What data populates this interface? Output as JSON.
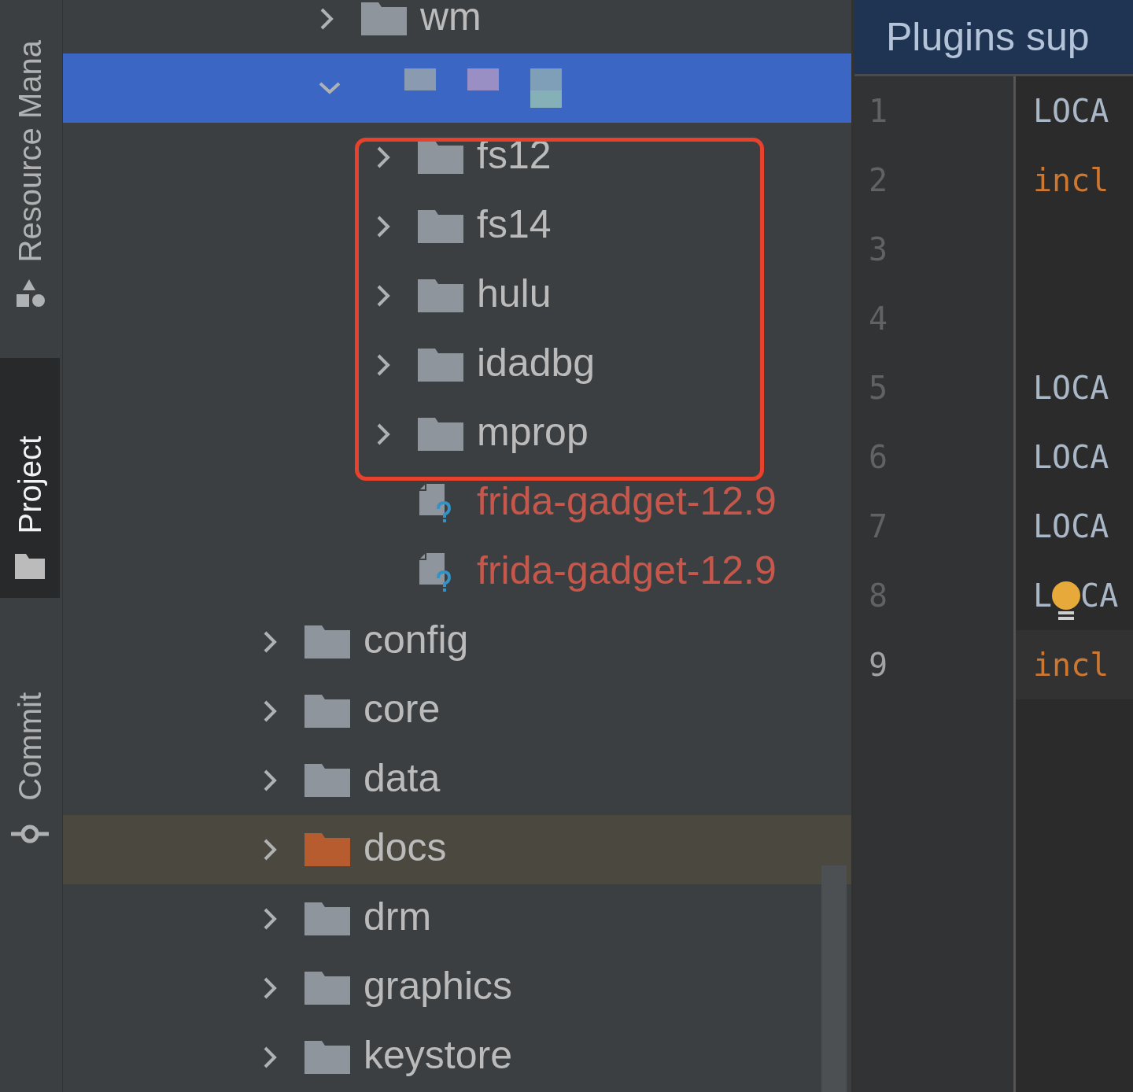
{
  "tool_window_bar": {
    "tabs": [
      {
        "label": "Resource Mana",
        "selected": false
      },
      {
        "label": "Project",
        "selected": true
      },
      {
        "label": "Commit",
        "selected": false
      }
    ]
  },
  "project_tree": {
    "scrolled_branch": [
      {
        "kind": "folder",
        "label": "wm",
        "expanded": false,
        "selected": false,
        "highlighted": false
      },
      {
        "kind": "redacted_folder",
        "expanded": true,
        "selected": true,
        "highlighted": false,
        "children": [
          {
            "kind": "folder",
            "label": "fs12",
            "expanded": false,
            "selected": false,
            "highlighted": false
          },
          {
            "kind": "folder",
            "label": "fs14",
            "expanded": false,
            "selected": false,
            "highlighted": false
          },
          {
            "kind": "folder",
            "label": "hulu",
            "expanded": false,
            "selected": false,
            "highlighted": false
          },
          {
            "kind": "folder",
            "label": "idadbg",
            "expanded": false,
            "selected": false,
            "highlighted": false
          },
          {
            "kind": "folder",
            "label": "mprop",
            "expanded": false,
            "selected": false,
            "highlighted": false
          },
          {
            "kind": "unknown_file",
            "label": "frida-gadget-12.9",
            "selected": false,
            "highlighted": false
          },
          {
            "kind": "unknown_file",
            "label": "frida-gadget-12.9",
            "selected": false,
            "highlighted": false
          }
        ]
      }
    ],
    "items": [
      {
        "kind": "folder",
        "label": "config",
        "expanded": false,
        "selected": false,
        "highlighted": false
      },
      {
        "kind": "folder",
        "label": "core",
        "expanded": false,
        "selected": false,
        "highlighted": false
      },
      {
        "kind": "folder",
        "label": "data",
        "expanded": false,
        "selected": false,
        "highlighted": false
      },
      {
        "kind": "excluded_folder",
        "label": "docs",
        "expanded": false,
        "selected": false,
        "highlighted": true
      },
      {
        "kind": "folder",
        "label": "drm",
        "expanded": false,
        "selected": false,
        "highlighted": false
      },
      {
        "kind": "folder",
        "label": "graphics",
        "expanded": false,
        "selected": false,
        "highlighted": false
      },
      {
        "kind": "folder",
        "label": "keystore",
        "expanded": false,
        "selected": false,
        "highlighted": false
      }
    ]
  },
  "editor": {
    "banner": "Plugins sup",
    "lines": [
      {
        "number": "1",
        "kind": "plain",
        "text": "LOCA",
        "current": false
      },
      {
        "number": "2",
        "kind": "keyword",
        "text": "incl",
        "current": false
      },
      {
        "number": "3",
        "current": false
      },
      {
        "number": "4",
        "current": false
      },
      {
        "number": "5",
        "kind": "plain",
        "text": "LOCA",
        "current": false
      },
      {
        "number": "6",
        "kind": "plain",
        "text": "LOCA",
        "current": false
      },
      {
        "number": "7",
        "kind": "plain",
        "text": "LOCA",
        "current": false
      },
      {
        "number": "8",
        "kind": "plain",
        "text": "L",
        "bulb": true,
        "text_after": "CA",
        "current": false
      },
      {
        "number": "9",
        "kind": "keyword",
        "text": "incl",
        "current": true
      }
    ]
  }
}
